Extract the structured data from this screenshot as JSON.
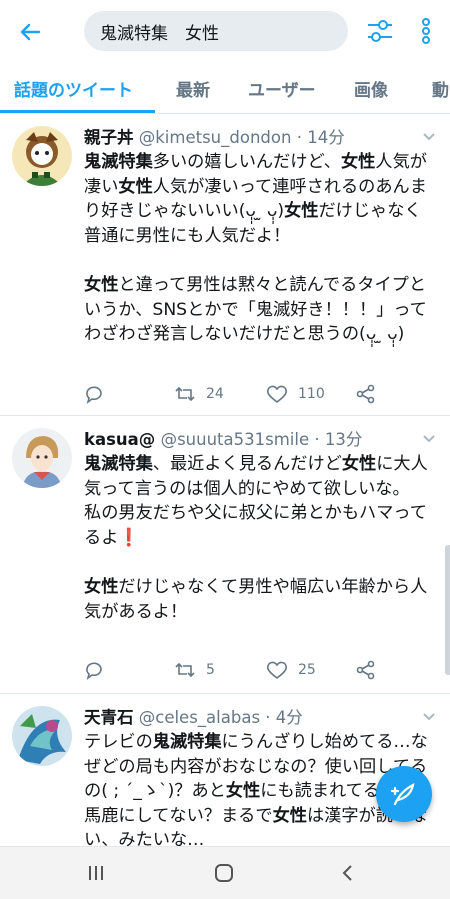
{
  "search": {
    "query": "鬼滅特集　女性"
  },
  "tabs": [
    {
      "label": "話題のツイート",
      "active": true
    },
    {
      "label": "最新"
    },
    {
      "label": "ユーザー"
    },
    {
      "label": "画像"
    },
    {
      "label": "動"
    }
  ],
  "tweets": [
    {
      "name": "親子丼",
      "handle": "@kimetsu_dondon",
      "time": "14分",
      "reply_count": "",
      "retweet_count": "24",
      "like_count": "110",
      "paragraphs": [
        [
          {
            "b": "鬼滅特集"
          },
          {
            "t": "多いの嬉しいんだけど、"
          },
          {
            "b": "女性"
          },
          {
            "t": "人気が凄い"
          },
          {
            "b": "女性"
          },
          {
            "t": "人気が凄いって連呼されるのあんまり好きじゃないいい(ᴗ̩̩ ̫ ᴗ̩̩)"
          },
          {
            "b": "女性"
          },
          {
            "t": "だけじゃなく普通に男性にも人気だよ！"
          }
        ],
        [
          {
            "b": "女性"
          },
          {
            "t": "と違って男性は黙々と読んでるタイプというか、SNSとかで「鬼滅好き！！！」ってわざわざ発言しないだけだと思うの(ᴗ̩̩ ̫ ᴗ̩̩)"
          }
        ]
      ]
    },
    {
      "name": "kasua@",
      "handle": "@suuuta531smile",
      "time": "13分",
      "reply_count": "",
      "retweet_count": "5",
      "like_count": "25",
      "paragraphs": [
        [
          {
            "b": "鬼滅特集"
          },
          {
            "t": "、最近よく見るんだけど"
          },
          {
            "b": "女性"
          },
          {
            "t": "に大人気って言うのは個人的にやめて欲しいな。\n私の男友だちや父に叔父に弟とかもハマってるよ"
          },
          {
            "e": "❗"
          }
        ],
        [
          {
            "b": "女性"
          },
          {
            "t": "だけじゃなくて男性や幅広い年齢から人気があるよ！"
          }
        ]
      ]
    },
    {
      "name": "天青石",
      "handle": "@celes_alabas",
      "time": "4分",
      "reply_count": "",
      "retweet_count": "",
      "like_count": "",
      "paragraphs": [
        [
          {
            "t": "テレビの"
          },
          {
            "b": "鬼滅特集"
          },
          {
            "t": "にうんざりし始めてる…なぜどの局も内容がおなじなの？使い回してるの( ; ´_ゝ`)？あと"
          },
          {
            "b": "女性"
          },
          {
            "t": "にも読まれてるとか女馬鹿にしてない？まるで"
          },
          {
            "b": "女性"
          },
          {
            "t": "は漢字が読めない、みたいな…"
          }
        ]
      ]
    }
  ],
  "colors": {
    "accent": "#1da1f2",
    "muted": "#657786",
    "divider": "#e1e8ed",
    "search_bg": "#e6ecf0",
    "alert": "#e0245e"
  },
  "icons": [
    "back-arrow-icon",
    "filter-sliders-icon",
    "more-vertical-icon",
    "chevron-down-icon",
    "reply-icon",
    "retweet-icon",
    "like-icon",
    "share-icon",
    "compose-feather-icon",
    "recent-apps-icon",
    "home-icon",
    "back-icon"
  ]
}
